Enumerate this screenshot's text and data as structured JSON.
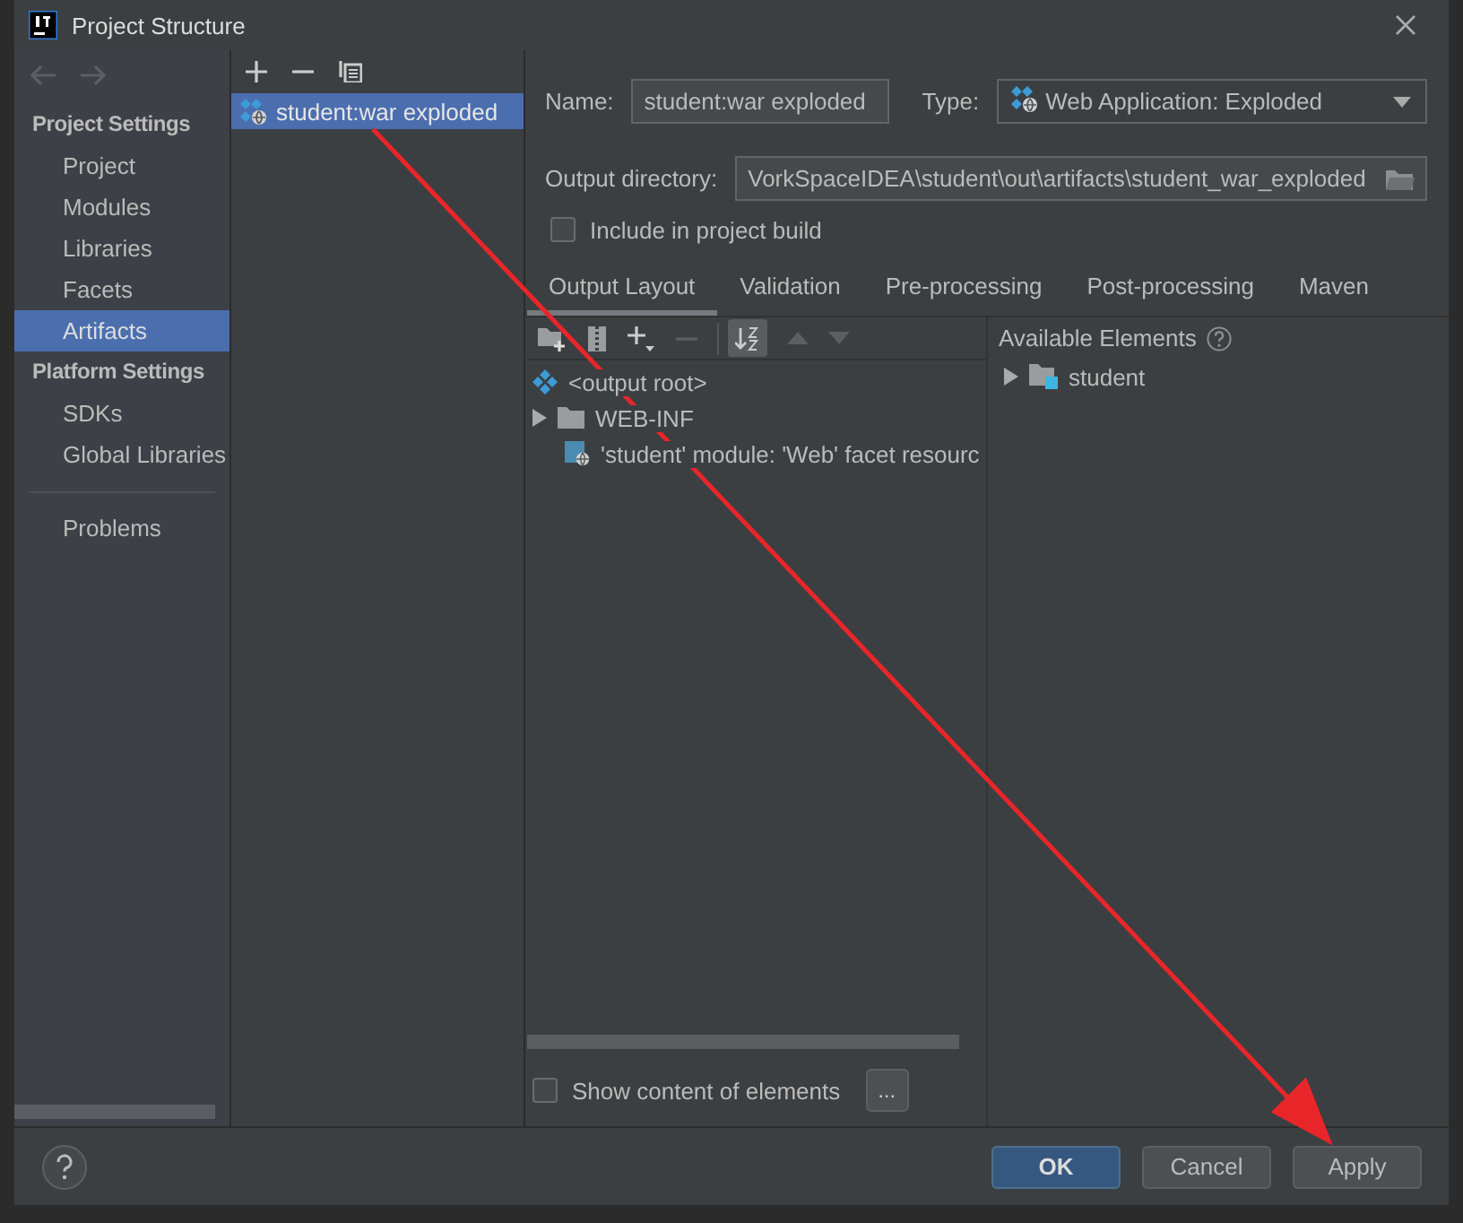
{
  "window": {
    "title": "Project Structure"
  },
  "sidebar": {
    "sections": [
      {
        "header": "Project Settings",
        "items": [
          {
            "label": "Project",
            "selected": false
          },
          {
            "label": "Modules",
            "selected": false
          },
          {
            "label": "Libraries",
            "selected": false
          },
          {
            "label": "Facets",
            "selected": false
          },
          {
            "label": "Artifacts",
            "selected": true
          }
        ]
      },
      {
        "header": "Platform Settings",
        "items": [
          {
            "label": "SDKs",
            "selected": false
          },
          {
            "label": "Global Libraries",
            "selected": false
          }
        ]
      }
    ],
    "extra_items": [
      {
        "label": "Problems",
        "selected": false
      }
    ]
  },
  "artifacts": [
    {
      "label": "student:war exploded",
      "selected": true
    }
  ],
  "form": {
    "name_label": "Name:",
    "name_value": "student:war exploded",
    "type_label": "Type:",
    "type_value": "Web Application: Exploded",
    "output_label": "Output directory:",
    "output_value": "VorkSpaceIDEA\\student\\out\\artifacts\\student_war_exploded",
    "include": {
      "label": "Include in project build",
      "checked": false
    }
  },
  "tabs": [
    {
      "label": "Output Layout",
      "selected": true
    },
    {
      "label": "Validation",
      "selected": false
    },
    {
      "label": "Pre-processing",
      "selected": false
    },
    {
      "label": "Post-processing",
      "selected": false
    },
    {
      "label": "Maven",
      "selected": false
    }
  ],
  "layout_tree": [
    {
      "label": "<output root>",
      "kind": "root"
    },
    {
      "label": "WEB-INF",
      "kind": "folder"
    },
    {
      "label": "'student' module: 'Web' facet resourc",
      "kind": "facet"
    }
  ],
  "available": {
    "title": "Available Elements",
    "items": [
      {
        "label": "student",
        "kind": "module"
      }
    ]
  },
  "show_content": {
    "label": "Show content of elements",
    "checked": false,
    "more": "..."
  },
  "buttons": [
    {
      "label": "OK",
      "kind": "primary"
    },
    {
      "label": "Cancel",
      "kind": "normal"
    },
    {
      "label": "Apply",
      "kind": "normal"
    }
  ]
}
